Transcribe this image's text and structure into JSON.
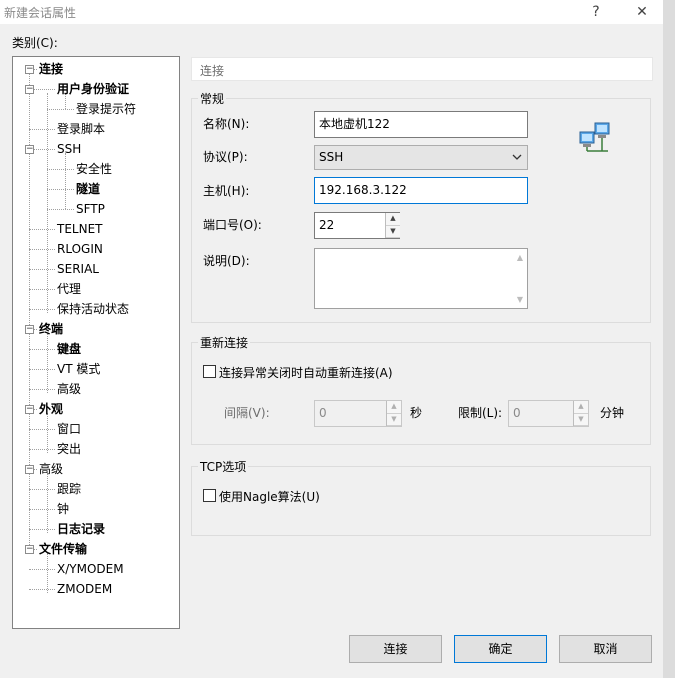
{
  "window": {
    "title": "新建会话属性",
    "help_label": "?",
    "close_label": "✕"
  },
  "category_label": "类别(C):",
  "tree": {
    "items": [
      {
        "label": "连接",
        "bold": true,
        "expander": "−"
      },
      {
        "label": "用户身份验证",
        "bold": true,
        "expander": "−"
      },
      {
        "label": "登录提示符",
        "bold": false
      },
      {
        "label": "登录脚本",
        "bold": false
      },
      {
        "label": "SSH",
        "bold": false,
        "expander": "−"
      },
      {
        "label": "安全性",
        "bold": false
      },
      {
        "label": "隧道",
        "bold": true
      },
      {
        "label": "SFTP",
        "bold": false
      },
      {
        "label": "TELNET",
        "bold": false
      },
      {
        "label": "RLOGIN",
        "bold": false
      },
      {
        "label": "SERIAL",
        "bold": false
      },
      {
        "label": "代理",
        "bold": false
      },
      {
        "label": "保持活动状态",
        "bold": false
      },
      {
        "label": "终端",
        "bold": true,
        "expander": "−"
      },
      {
        "label": "键盘",
        "bold": true
      },
      {
        "label": "VT 模式",
        "bold": false
      },
      {
        "label": "高级",
        "bold": false
      },
      {
        "label": "外观",
        "bold": true,
        "expander": "−"
      },
      {
        "label": "窗口",
        "bold": false
      },
      {
        "label": "突出",
        "bold": false
      },
      {
        "label": "高级",
        "bold": false,
        "expander": "−"
      },
      {
        "label": "跟踪",
        "bold": false
      },
      {
        "label": "钟",
        "bold": false
      },
      {
        "label": "日志记录",
        "bold": true
      },
      {
        "label": "文件传输",
        "bold": true,
        "expander": "−"
      },
      {
        "label": "X/YMODEM",
        "bold": false
      },
      {
        "label": "ZMODEM",
        "bold": false
      }
    ]
  },
  "panel_title": "连接",
  "general": {
    "title": "常规",
    "name_label": "名称(N):",
    "name_value": "本地虚机122",
    "protocol_label": "协议(P):",
    "protocol_value": "SSH",
    "host_label": "主机(H):",
    "host_value": "192.168.3.122",
    "port_label": "端口号(O):",
    "port_value": "22",
    "desc_label": "说明(D):",
    "desc_value": ""
  },
  "reconnect": {
    "title": "重新连接",
    "auto_label": "连接异常关闭时自动重新连接(A)",
    "interval_label": "间隔(V):",
    "interval_value": "0",
    "seconds_label": "秒",
    "limit_label": "限制(L):",
    "limit_value": "0",
    "minutes_label": "分钟"
  },
  "tcp": {
    "title": "TCP选项",
    "nagle_label": "使用Nagle算法(U)"
  },
  "buttons": {
    "connect": "连接",
    "ok": "确定",
    "cancel": "取消"
  },
  "icons": {
    "network": "network-computers-icon",
    "dropdown": "chevron-down-icon",
    "spin_up": "spin-up-icon",
    "spin_down": "spin-down-icon"
  },
  "colors": {
    "focus_border": "#0078d7",
    "window_bg": "#f0f0f0"
  }
}
